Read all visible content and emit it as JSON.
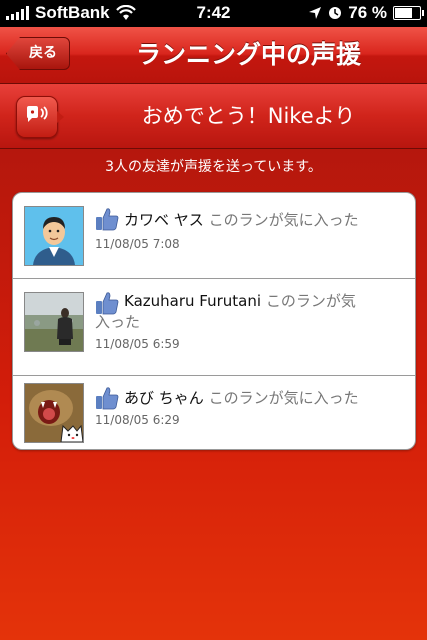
{
  "status_bar": {
    "carrier": "SoftBank",
    "time": "7:42",
    "battery": "76 %",
    "battery_level": 0.76
  },
  "nav": {
    "back_label": "戻る",
    "title": "ランニング中の声援"
  },
  "banner": {
    "text": "おめでとう！Nikeより"
  },
  "subtitle": "3人の友達が声援を送っています。",
  "cheers": [
    {
      "name": "カワベ ヤス",
      "action": "このランが気に入った",
      "action_overflow": "",
      "timestamp": "11/08/05  7:08",
      "avatar": "cartoon-avatar"
    },
    {
      "name": "Kazuharu Furutani",
      "action": "このランが気",
      "action_overflow": "入った",
      "timestamp": "11/08/05  6:59",
      "avatar": "photo-avatar"
    },
    {
      "name": "あび ちゃん",
      "action": "このランが気に入った",
      "action_overflow": "",
      "timestamp": "11/08/05  6:29",
      "avatar": "cat-avatar"
    }
  ],
  "colors": {
    "accent": "#d31d0a",
    "like_blue": "#5b7fc1"
  }
}
